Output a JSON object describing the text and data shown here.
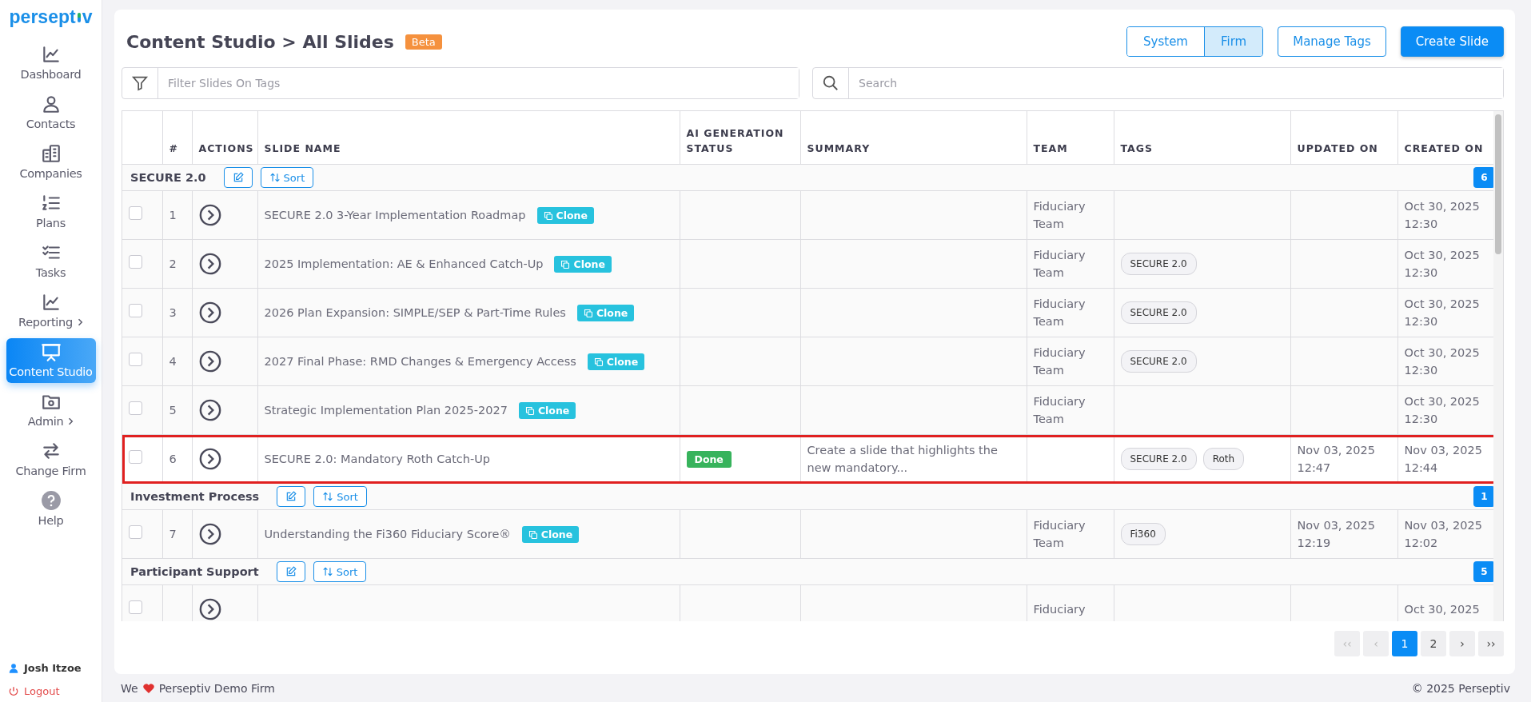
{
  "brand": {
    "before": "persept",
    "after": "v"
  },
  "sidebar": {
    "items": [
      {
        "label": "Dashboard",
        "kind": "chart",
        "selected": false,
        "submenu": false
      },
      {
        "label": "Contacts",
        "kind": "user",
        "selected": false,
        "submenu": false
      },
      {
        "label": "Companies",
        "kind": "building",
        "selected": false,
        "submenu": false
      },
      {
        "label": "Plans",
        "kind": "numlist",
        "selected": false,
        "submenu": false
      },
      {
        "label": "Tasks",
        "kind": "checklist",
        "selected": false,
        "submenu": false
      },
      {
        "label": "Reporting",
        "kind": "chart",
        "selected": false,
        "submenu": true
      },
      {
        "label": "Content Studio",
        "kind": "presentation",
        "selected": true,
        "submenu": false
      },
      {
        "label": "Admin",
        "kind": "folder",
        "selected": false,
        "submenu": true
      },
      {
        "label": "Change Firm",
        "kind": "swap",
        "selected": false,
        "submenu": false
      },
      {
        "label": "Help",
        "kind": "help",
        "selected": false,
        "submenu": false
      }
    ],
    "user": "Josh Itzoe",
    "logout": "Logout"
  },
  "header": {
    "title": "Content Studio > All Slides",
    "badge": "Beta",
    "scope": [
      {
        "label": "System",
        "selected": false
      },
      {
        "label": "Firm",
        "selected": true
      }
    ],
    "buttons": [
      {
        "label": "Manage Tags",
        "kind": "outline"
      },
      {
        "label": "Create Slide",
        "kind": "primary"
      }
    ]
  },
  "filter": {
    "placeholder": "Filter Slides On Tags"
  },
  "search": {
    "placeholder": "Search"
  },
  "table": {
    "columns": [
      "#",
      "ACTIONS",
      "SLIDE NAME",
      "AI GENERATION STATUS",
      "SUMMARY",
      "TEAM",
      "TAGS",
      "UPDATED ON",
      "CREATED ON"
    ],
    "groups": [
      {
        "name": "SECURE 2.0",
        "count": "6",
        "sort": "Sort",
        "rows": [
          {
            "number": "1",
            "name": "SECURE 2.0 3-Year Implementation Roadmap",
            "clone": "Clone",
            "team": "Fiduciary Team",
            "tags": [],
            "created": "Oct 30, 2025 12:30",
            "checked": false,
            "highlighted": false
          },
          {
            "number": "2",
            "name": "2025 Implementation: AE & Enhanced Catch-Up",
            "clone": "Clone",
            "team": "Fiduciary Team",
            "tags": [
              "SECURE 2.0"
            ],
            "created": "Oct 30, 2025 12:30",
            "checked": false,
            "highlighted": false
          },
          {
            "number": "3",
            "name": "2026 Plan Expansion: SIMPLE/SEP & Part-Time Rules",
            "clone": "Clone",
            "team": "Fiduciary Team",
            "tags": [
              "SECURE 2.0"
            ],
            "created": "Oct 30, 2025 12:30",
            "checked": false,
            "highlighted": false
          },
          {
            "number": "4",
            "name": "2027 Final Phase: RMD Changes & Emergency Access",
            "clone": "Clone",
            "team": "Fiduciary Team",
            "tags": [
              "SECURE 2.0"
            ],
            "created": "Oct 30, 2025 12:30",
            "checked": false,
            "highlighted": false
          },
          {
            "number": "5",
            "name": "Strategic Implementation Plan 2025-2027",
            "clone": "Clone",
            "team": "Fiduciary Team",
            "tags": [],
            "created": "Oct 30, 2025 12:30",
            "checked": false,
            "highlighted": false
          },
          {
            "number": "6",
            "name": "SECURE 2.0: Mandatory Roth Catch-Up",
            "status": "Done",
            "summary": "Create a slide that highlights the new mandatory...",
            "tags": [
              "SECURE 2.0",
              "Roth"
            ],
            "updated": "Nov 03, 2025 12:47",
            "created": "Nov 03, 2025 12:44",
            "checked": false,
            "highlighted": true
          }
        ]
      },
      {
        "name": "Investment Process",
        "count": "1",
        "sort": "Sort",
        "rows": [
          {
            "number": "7",
            "name": "Understanding the Fi360 Fiduciary Score®",
            "clone": "Clone",
            "team": "Fiduciary Team",
            "tags": [
              "Fi360"
            ],
            "updated": "Nov 03, 2025 12:19",
            "created": "Nov 03, 2025 12:02",
            "checked": false,
            "highlighted": false
          }
        ]
      },
      {
        "name": "Participant Support",
        "count": "5",
        "sort": "Sort",
        "rows": [
          {
            "team": "Fiduciary",
            "tags": [],
            "created": "Oct 30, 2025",
            "checked": false,
            "highlighted": false
          }
        ]
      }
    ]
  },
  "pagination": [
    {
      "label": "‹‹",
      "selected": false,
      "disabled": true
    },
    {
      "label": "‹",
      "selected": false,
      "disabled": true
    },
    {
      "label": "1",
      "selected": true,
      "disabled": false
    },
    {
      "label": "2",
      "selected": false,
      "disabled": false
    },
    {
      "label": "›",
      "selected": false,
      "disabled": false
    },
    {
      "label": "››",
      "selected": false,
      "disabled": false
    }
  ],
  "footer": {
    "before": "We",
    "after": "Perseptiv Demo Firm",
    "right": "© 2025 Perseptiv"
  }
}
